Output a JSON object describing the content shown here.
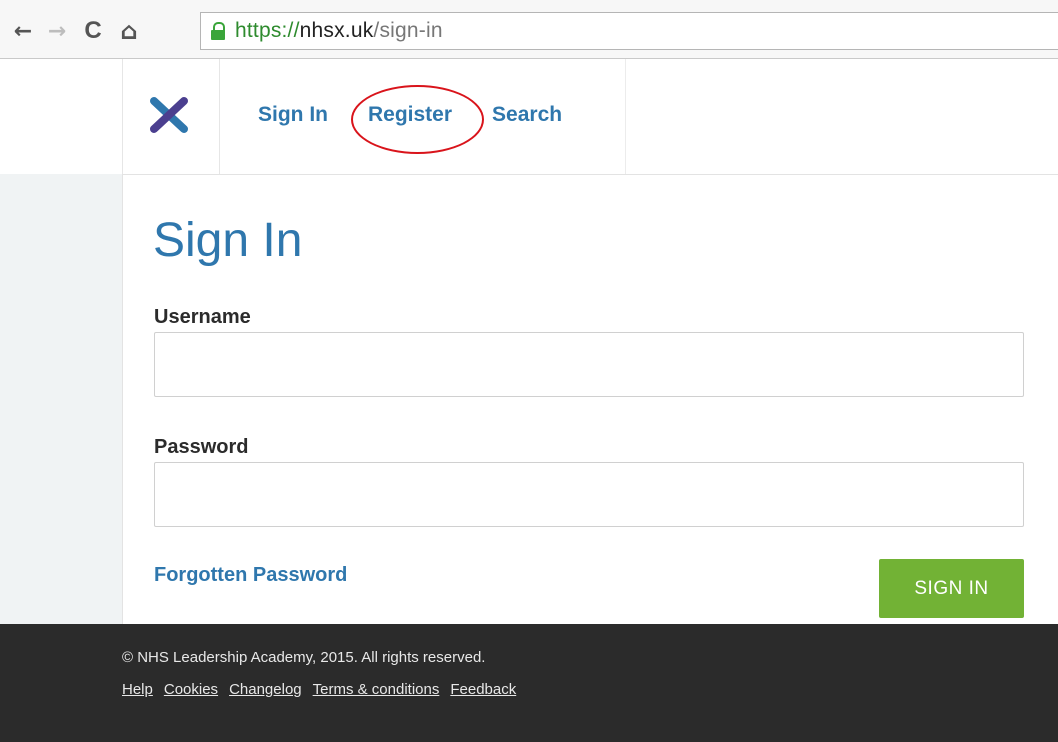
{
  "browser": {
    "back_icon": "←",
    "forward_icon": "→",
    "reload_icon": "C",
    "home_icon": "⌂",
    "url_scheme": "https://",
    "url_host": "nhsx.uk",
    "url_path": "/sign-in"
  },
  "header": {
    "logo_accent_colors": [
      "#2f77ad",
      "#6d3b8e"
    ],
    "nav": {
      "sign_in": "Sign In",
      "register": "Register",
      "search": "Search"
    },
    "annotation_color": "#d9141b"
  },
  "main": {
    "title": "Sign In",
    "username_label": "Username",
    "username_value": "",
    "password_label": "Password",
    "password_value": "",
    "forgot_label": "Forgotten Password",
    "submit_label": "SIGN IN",
    "accent_color": "#2f77ad",
    "button_color": "#72b235"
  },
  "footer": {
    "copyright": "© NHS Leadership Academy, 2015. All rights reserved.",
    "links": [
      "Help",
      "Cookies",
      "Changelog",
      "Terms & conditions",
      "Feedback"
    ]
  }
}
